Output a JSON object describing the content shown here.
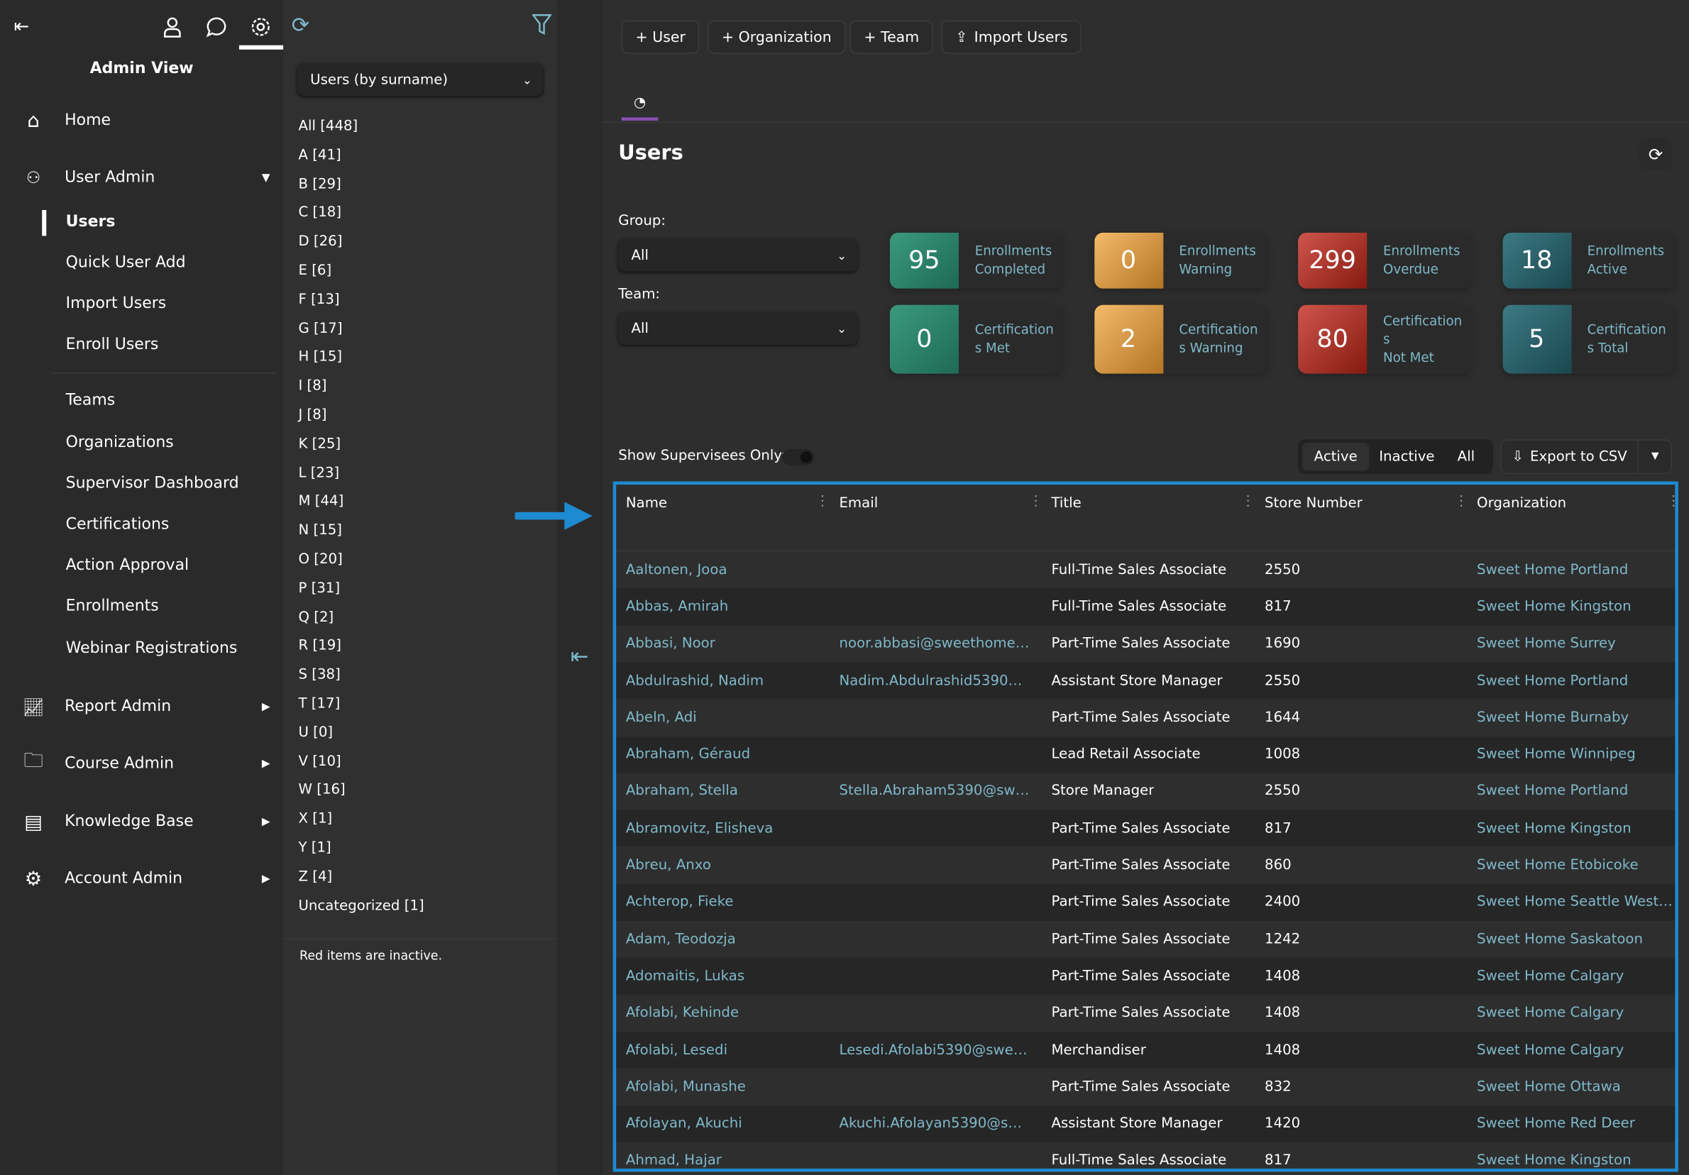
{
  "sidebar": {
    "title": "Admin View",
    "top_icons": [
      "collapse-icon",
      "user-icon",
      "chat-icon",
      "gear-icon"
    ],
    "items": [
      {
        "label": "Home",
        "icon": "home-icon"
      },
      {
        "label": "User Admin",
        "icon": "user-admin-icon",
        "expanded": true
      },
      {
        "label": "Report Admin",
        "icon": "chart-icon"
      },
      {
        "label": "Course Admin",
        "icon": "folder-icon"
      },
      {
        "label": "Knowledge Base",
        "icon": "book-icon"
      },
      {
        "label": "Account Admin",
        "icon": "gear-icon"
      }
    ],
    "sub_items": [
      "Users",
      "Quick User Add",
      "Import Users",
      "Enroll Users",
      "Teams",
      "Organizations",
      "Supervisor Dashboard",
      "Certifications",
      "Action Approval",
      "Enrollments",
      "Webinar Registrations"
    ],
    "active_sub": "Users"
  },
  "letters": {
    "dropdown": "Users (by surname)",
    "items": [
      "All [448]",
      "A [41]",
      "B [29]",
      "C [18]",
      "D [26]",
      "E [6]",
      "F [13]",
      "G [17]",
      "H [15]",
      "I [8]",
      "J [8]",
      "K [25]",
      "L [23]",
      "M [44]",
      "N [15]",
      "O [20]",
      "P [31]",
      "Q [2]",
      "R [19]",
      "S [38]",
      "T [17]",
      "U [0]",
      "V [10]",
      "W [16]",
      "X [1]",
      "Y [1]",
      "Z [4]",
      "Uncategorized [1]"
    ],
    "note": "Red items are inactive."
  },
  "toolbar": {
    "buttons": [
      "+ User",
      "+ Organization",
      "+ Team",
      "Import Users"
    ]
  },
  "page": {
    "title": "Users",
    "group_label": "Group:",
    "group_value": "All",
    "team_label": "Team:",
    "team_value": "All"
  },
  "cards": [
    {
      "value": "95",
      "label": "Enrollments\nCompleted",
      "color": "#2f8a6c"
    },
    {
      "value": "0",
      "label": "Enrollments\nWarning",
      "color": "#e0a24c"
    },
    {
      "value": "299",
      "label": "Enrollments\nOverdue",
      "color": "#b8392f"
    },
    {
      "value": "18",
      "label": "Enrollments\nActive",
      "color": "#2c616b"
    },
    {
      "value": "0",
      "label": "Certification\ns Met",
      "color": "#2f8a6c"
    },
    {
      "value": "2",
      "label": "Certification\ns Warning",
      "color": "#e0a24c"
    },
    {
      "value": "80",
      "label": "Certification\ns\nNot Met",
      "color": "#b8392f"
    },
    {
      "value": "5",
      "label": "Certification\ns Total",
      "color": "#2c616b"
    }
  ],
  "filters": {
    "supervisees_label": "Show Supervisees Only:",
    "supervisees_on": false,
    "status_options": [
      "Active",
      "Inactive",
      "All"
    ],
    "status_selected": "Active",
    "export_label": "Export to CSV"
  },
  "table": {
    "columns": [
      "Name",
      "Email",
      "Title",
      "Store Number",
      "Organization"
    ],
    "rows": [
      [
        "Aaltonen, Jooa",
        "",
        "Full-Time Sales Associate",
        "2550",
        "Sweet Home Portland"
      ],
      [
        "Abbas, Amirah",
        "",
        "Full-Time Sales Associate",
        "817",
        "Sweet Home Kingston"
      ],
      [
        "Abbasi, Noor",
        "noor.abbasi@sweethomeele...",
        "Part-Time Sales Associate",
        "1690",
        "Sweet Home Surrey"
      ],
      [
        "Abdulrashid, Nadim",
        "Nadim.Abdulrashid5390@s...",
        "Assistant Store Manager",
        "2550",
        "Sweet Home Portland"
      ],
      [
        "Abeln, Adi",
        "",
        "Part-Time Sales Associate",
        "1644",
        "Sweet Home Burnaby"
      ],
      [
        "Abraham, Géraud",
        "",
        "Lead Retail Associate",
        "1008",
        "Sweet Home Winnipeg"
      ],
      [
        "Abraham, Stella",
        "Stella.Abraham5390@sweet...",
        "Store Manager",
        "2550",
        "Sweet Home Portland"
      ],
      [
        "Abramovitz, Elisheva",
        "",
        "Part-Time Sales Associate",
        "817",
        "Sweet Home Kingston"
      ],
      [
        "Abreu, Anxo",
        "",
        "Part-Time Sales Associate",
        "860",
        "Sweet Home Etobicoke"
      ],
      [
        "Achterop, Fieke",
        "",
        "Part-Time Sales Associate",
        "2400",
        "Sweet Home Seattle Westlake"
      ],
      [
        "Adam, Teodozja",
        "",
        "Part-Time Sales Associate",
        "1242",
        "Sweet Home Saskatoon"
      ],
      [
        "Adomaitis, Lukas",
        "",
        "Part-Time Sales Associate",
        "1408",
        "Sweet Home Calgary"
      ],
      [
        "Afolabi, Kehinde",
        "",
        "Part-Time Sales Associate",
        "1408",
        "Sweet Home Calgary"
      ],
      [
        "Afolabi, Lesedi",
        "Lesedi.Afolabi5390@sweeth...",
        "Merchandiser",
        "1408",
        "Sweet Home Calgary"
      ],
      [
        "Afolabi, Munashe",
        "",
        "Part-Time Sales Associate",
        "832",
        "Sweet Home Ottawa"
      ],
      [
        "Afolayan, Akuchi",
        "Akuchi.Afolayan5390@swee...",
        "Assistant Store Manager",
        "1420",
        "Sweet Home Red Deer"
      ],
      [
        "Ahmad, Hajar",
        "",
        "Full-Time Sales Associate",
        "817",
        "Sweet Home Kingston"
      ]
    ]
  },
  "colors": {
    "accent": "#1e8ad0",
    "link": "#7fb9c9",
    "tab_underline": "#8a4fb0"
  }
}
